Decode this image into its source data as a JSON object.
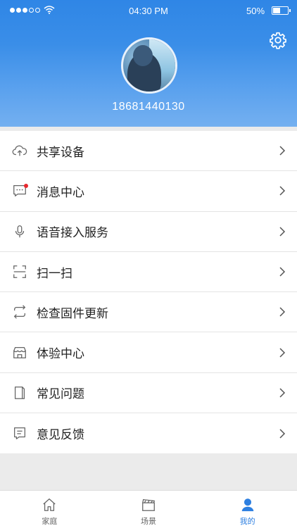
{
  "status_bar": {
    "time": "04:30 PM",
    "battery": "50%",
    "battery_level": 0.5
  },
  "profile": {
    "phone": "18681440130"
  },
  "menu": [
    {
      "label": "共享设备",
      "icon": "cloud-upload-icon"
    },
    {
      "label": "消息中心",
      "icon": "message-icon",
      "badge": true
    },
    {
      "label": "语音接入服务",
      "icon": "microphone-icon"
    },
    {
      "label": "扫一扫",
      "icon": "scan-icon"
    },
    {
      "label": "检查固件更新",
      "icon": "refresh-icon"
    },
    {
      "label": "体验中心",
      "icon": "store-icon"
    },
    {
      "label": "常见问题",
      "icon": "book-icon"
    },
    {
      "label": "意见反馈",
      "icon": "feedback-icon"
    }
  ],
  "tabs": [
    {
      "label": "家庭",
      "icon": "home-icon",
      "active": false
    },
    {
      "label": "场景",
      "icon": "clapperboard-icon",
      "active": false
    },
    {
      "label": "我的",
      "icon": "user-icon",
      "active": true
    }
  ],
  "colors": {
    "accent": "#2d7fe0",
    "header": "#3a8ee8",
    "badge": "#e8282e"
  }
}
